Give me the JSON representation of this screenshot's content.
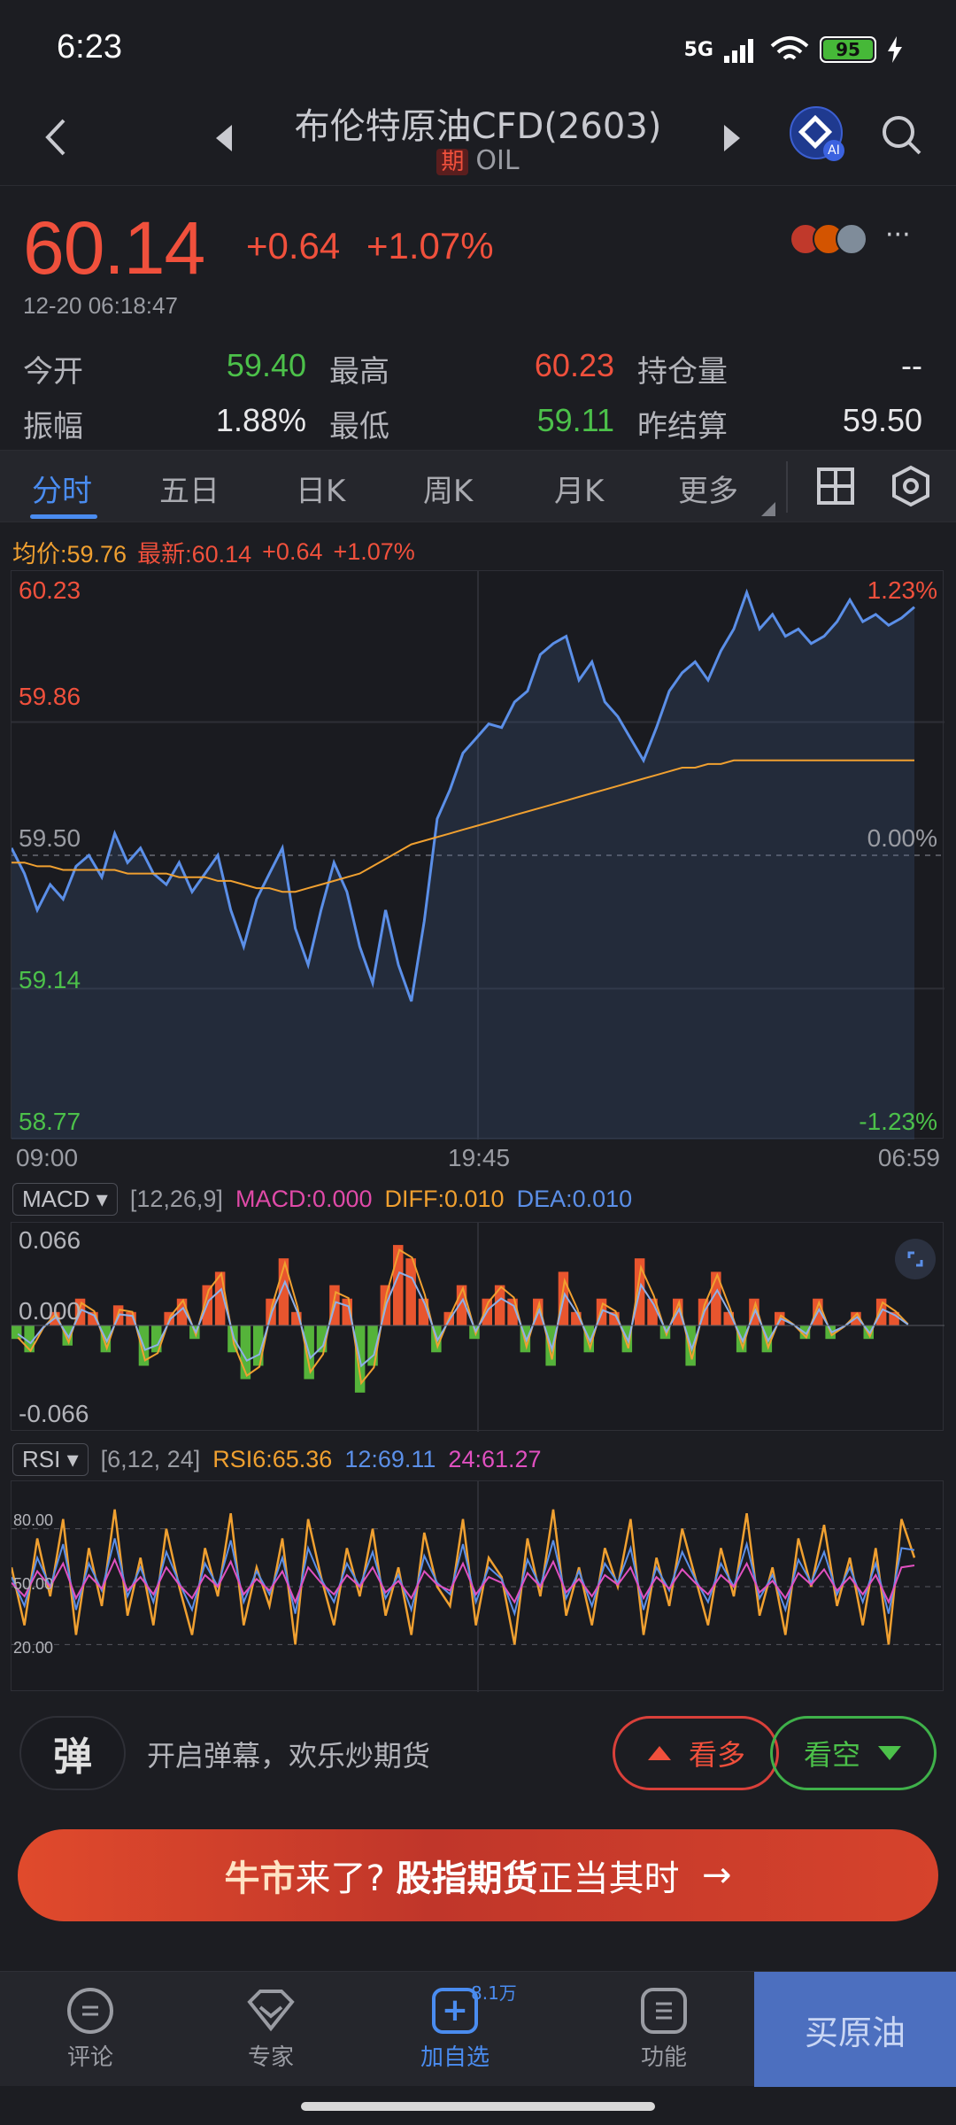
{
  "status_bar": {
    "time": "6:23",
    "network": "5G",
    "battery": "95"
  },
  "header": {
    "title": "布伦特原油CFD(2603)",
    "tag": "期",
    "symbol": "OIL",
    "ai_badge": "AI"
  },
  "quote": {
    "price": "60.14",
    "change": "+0.64",
    "change_pct": "+1.07%",
    "timestamp": "12-20 06:18:47",
    "stats": [
      {
        "label": "今开",
        "value": "59.40",
        "color": "green"
      },
      {
        "label": "最高",
        "value": "60.23",
        "color": "red"
      },
      {
        "label": "持仓量",
        "value": "--",
        "color": "white"
      },
      {
        "label": "振幅",
        "value": "1.88%",
        "color": "white"
      },
      {
        "label": "最低",
        "value": "59.11",
        "color": "green"
      },
      {
        "label": "昨结算",
        "value": "59.50",
        "color": "white"
      }
    ]
  },
  "tabs": [
    "分时",
    "五日",
    "日K",
    "周K",
    "月K",
    "更多"
  ],
  "chart_legend": {
    "avg": "均价:59.76",
    "latest": "最新:60.14",
    "change": "+0.64",
    "change_pct": "+1.07%"
  },
  "chart_data": [
    {
      "type": "line",
      "x_ticks": [
        "09:00",
        "19:45",
        "06:59"
      ],
      "y_ticks": [
        "60.23",
        "59.86",
        "59.50",
        "59.14",
        "58.77"
      ],
      "y_right_ticks": [
        "1.23%",
        "0.00%",
        "-1.23%"
      ],
      "ylim": [
        58.77,
        60.23
      ],
      "prev_settle": 59.5,
      "series": [
        {
          "name": "最新",
          "color": "#5b8fe8",
          "values": [
            59.52,
            59.45,
            59.35,
            59.42,
            59.38,
            59.47,
            59.5,
            59.44,
            59.56,
            59.48,
            59.52,
            59.45,
            59.42,
            59.48,
            59.4,
            59.45,
            59.5,
            59.35,
            59.25,
            59.38,
            59.45,
            59.52,
            59.3,
            59.2,
            59.35,
            59.48,
            59.4,
            59.25,
            59.15,
            59.35,
            59.2,
            59.1,
            59.32,
            59.6,
            59.68,
            59.78,
            59.82,
            59.86,
            59.85,
            59.92,
            59.95,
            60.05,
            60.08,
            60.1,
            59.98,
            60.03,
            59.92,
            59.88,
            59.82,
            59.76,
            59.85,
            59.95,
            60.0,
            60.03,
            59.98,
            60.06,
            60.12,
            60.22,
            60.12,
            60.16,
            60.1,
            60.12,
            60.08,
            60.1,
            60.14,
            60.2,
            60.14,
            60.16,
            60.13,
            60.15,
            60.18
          ]
        },
        {
          "name": "均价",
          "color": "#f0a030",
          "values": [
            59.48,
            59.48,
            59.47,
            59.47,
            59.46,
            59.46,
            59.46,
            59.46,
            59.46,
            59.45,
            59.45,
            59.45,
            59.45,
            59.44,
            59.44,
            59.44,
            59.43,
            59.43,
            59.42,
            59.41,
            59.41,
            59.4,
            59.4,
            59.41,
            59.42,
            59.43,
            59.44,
            59.45,
            59.47,
            59.49,
            59.51,
            59.53,
            59.54,
            59.55,
            59.56,
            59.57,
            59.58,
            59.59,
            59.6,
            59.61,
            59.62,
            59.63,
            59.64,
            59.65,
            59.66,
            59.67,
            59.68,
            59.69,
            59.7,
            59.71,
            59.72,
            59.73,
            59.74,
            59.74,
            59.75,
            59.75,
            59.76,
            59.76,
            59.76,
            59.76,
            59.76,
            59.76,
            59.76,
            59.76,
            59.76,
            59.76,
            59.76,
            59.76,
            59.76,
            59.76,
            59.76
          ]
        }
      ]
    },
    {
      "type": "bar",
      "indicator": "MACD",
      "params": "[12,26,9]",
      "labels": {
        "macd": "MACD:0.000",
        "diff": "DIFF:0.010",
        "dea": "DEA:0.010"
      },
      "y_ticks": [
        "0.066",
        "0.000",
        "-0.066"
      ],
      "ylim": [
        -0.066,
        0.066
      ],
      "values": [
        -0.01,
        -0.02,
        0.0,
        0.01,
        -0.015,
        0.02,
        0.01,
        -0.02,
        0.015,
        0.01,
        -0.03,
        -0.02,
        0.01,
        0.02,
        -0.01,
        0.03,
        0.04,
        -0.02,
        -0.04,
        -0.03,
        0.02,
        0.05,
        0.01,
        -0.04,
        -0.02,
        0.03,
        0.02,
        -0.05,
        -0.03,
        0.03,
        0.06,
        0.05,
        0.02,
        -0.02,
        0.01,
        0.03,
        -0.01,
        0.02,
        0.03,
        0.02,
        -0.02,
        0.02,
        -0.03,
        0.04,
        0.01,
        -0.02,
        0.02,
        0.01,
        -0.02,
        0.05,
        0.02,
        -0.01,
        0.02,
        -0.03,
        0.02,
        0.04,
        0.01,
        -0.02,
        0.02,
        -0.02,
        0.01,
        0.0,
        -0.01,
        0.02,
        -0.01,
        0.0,
        0.01,
        -0.01,
        0.02,
        0.01,
        0.0
      ]
    },
    {
      "type": "line",
      "indicator": "RSI",
      "params": "[6,12, 24]",
      "labels": {
        "rsi6": "RSI6:65.36",
        "rsi12": "12:69.11",
        "rsi24": "24:61.27"
      },
      "y_ticks": [
        "80.00",
        "50.00",
        "20.00"
      ],
      "ylim": [
        0,
        100
      ],
      "series": [
        {
          "name": "RSI6",
          "color": "#f0a030",
          "values": [
            60,
            30,
            75,
            45,
            85,
            25,
            70,
            40,
            90,
            35,
            65,
            30,
            80,
            50,
            25,
            70,
            45,
            88,
            30,
            60,
            40,
            75,
            20,
            85,
            55,
            30,
            70,
            45,
            80,
            35,
            60,
            25,
            78,
            50,
            40,
            85,
            30,
            65,
            55,
            20,
            75,
            45,
            90,
            35,
            60,
            30,
            70,
            50,
            85,
            25,
            65,
            40,
            80,
            55,
            30,
            70,
            45,
            88,
            35,
            60,
            25,
            75,
            50,
            82,
            40,
            65,
            30,
            70,
            20,
            85,
            65
          ]
        },
        {
          "name": "12",
          "color": "#5b8fe8",
          "values": [
            55,
            40,
            65,
            50,
            72,
            38,
            62,
            48,
            75,
            45,
            60,
            42,
            68,
            52,
            38,
            62,
            50,
            74,
            42,
            58,
            46,
            65,
            36,
            70,
            54,
            42,
            62,
            50,
            68,
            44,
            56,
            38,
            66,
            52,
            46,
            72,
            42,
            60,
            54,
            36,
            64,
            50,
            74,
            44,
            58,
            40,
            62,
            52,
            70,
            38,
            60,
            48,
            68,
            54,
            42,
            62,
            50,
            72,
            44,
            56,
            38,
            64,
            52,
            68,
            46,
            60,
            42,
            62,
            36,
            70,
            69
          ]
        },
        {
          "name": "24",
          "color": "#e050c0",
          "values": [
            52,
            45,
            58,
            50,
            62,
            44,
            56,
            49,
            64,
            48,
            55,
            46,
            60,
            51,
            44,
            56,
            50,
            63,
            46,
            54,
            48,
            58,
            42,
            60,
            52,
            46,
            56,
            50,
            60,
            47,
            53,
            44,
            58,
            51,
            48,
            62,
            46,
            55,
            52,
            42,
            57,
            50,
            63,
            47,
            54,
            45,
            56,
            51,
            60,
            44,
            55,
            49,
            59,
            52,
            46,
            56,
            50,
            62,
            47,
            53,
            44,
            57,
            51,
            59,
            48,
            55,
            46,
            56,
            42,
            60,
            61
          ]
        }
      ]
    }
  ],
  "interaction": {
    "danmu_icon": "弹",
    "danmu_text": "开启弹幕，欢乐炒期货",
    "bull": "看多",
    "bear": "看空"
  },
  "banner": {
    "part1": "牛市",
    "part2": "来了?",
    "part3": "股指期货",
    "part4": "正当其时",
    "arrow": "→"
  },
  "bottom_nav": {
    "items": [
      {
        "label": "评论",
        "icon": "comment-icon"
      },
      {
        "label": "专家",
        "icon": "expert-icon"
      },
      {
        "label": "加自选",
        "icon": "add-watchlist-icon",
        "badge": "8.1万"
      },
      {
        "label": "功能",
        "icon": "menu-icon"
      }
    ],
    "buy": "买原油"
  }
}
